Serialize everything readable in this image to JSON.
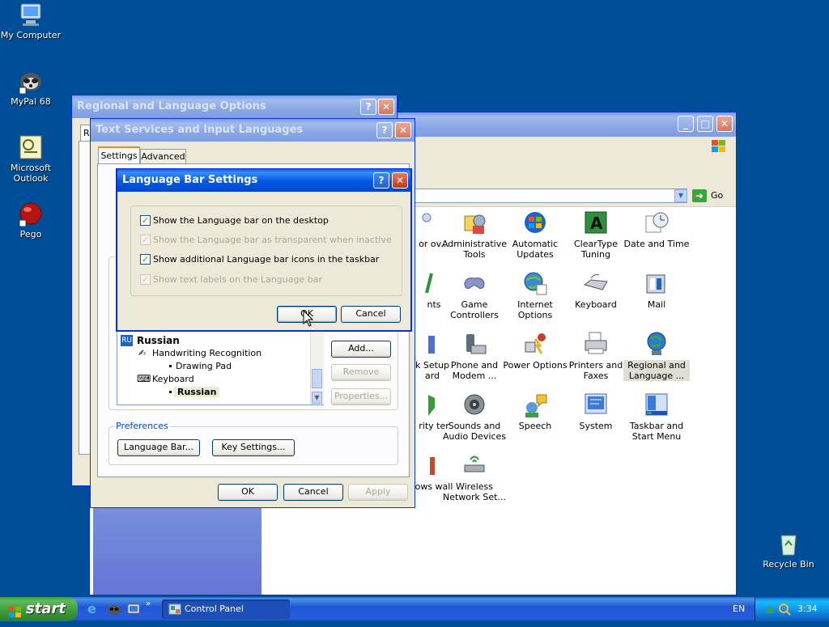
{
  "desktop": {
    "icons": [
      {
        "label": "My Computer"
      },
      {
        "label": "MyPal 68"
      },
      {
        "label": "Microsoft Outlook"
      },
      {
        "label": "Pego"
      },
      {
        "label": "Recycle Bin"
      }
    ]
  },
  "control_panel": {
    "go_label": "Go",
    "items": [
      {
        "label": "or ov..."
      },
      {
        "label": "Administrative Tools"
      },
      {
        "label": "Automatic Updates"
      },
      {
        "label": "ClearType Tuning"
      },
      {
        "label": "Date and Time"
      },
      {
        "label": "nts"
      },
      {
        "label": "Game Controllers"
      },
      {
        "label": "Internet Options"
      },
      {
        "label": "Keyboard"
      },
      {
        "label": "Mail"
      },
      {
        "label": "k Setup ard"
      },
      {
        "label": "Phone and Modem ..."
      },
      {
        "label": "Power Options"
      },
      {
        "label": "Printers and Faxes"
      },
      {
        "label": "Regional and Language ..."
      },
      {
        "label": "rity ter"
      },
      {
        "label": "Sounds and Audio Devices"
      },
      {
        "label": "Speech"
      },
      {
        "label": "System"
      },
      {
        "label": "Taskbar and Start Menu"
      },
      {
        "label": "ows wall"
      },
      {
        "label": "Wireless Network Set..."
      }
    ]
  },
  "regional_window": {
    "title": "Regional and Language Options",
    "tab_fragment": "R"
  },
  "text_services": {
    "title": "Text Services and Input Languages",
    "tabs": [
      "Settings",
      "Advanced"
    ],
    "tree": {
      "lang_code": "RU",
      "language": "Russian",
      "handwriting": "Handwriting Recognition",
      "drawing_pad": "Drawing Pad",
      "keyboard": "Keyboard",
      "keyboard_layout": "Russian"
    },
    "buttons": {
      "add": "Add...",
      "remove": "Remove",
      "properties": "Properties..."
    },
    "preferences": {
      "legend": "Preferences",
      "language_bar": "Language Bar...",
      "key_settings": "Key Settings..."
    },
    "footer": {
      "ok": "OK",
      "cancel": "Cancel",
      "apply": "Apply"
    }
  },
  "language_bar_dialog": {
    "title": "Language Bar Settings",
    "options": [
      {
        "label": "Show the Language bar on the desktop",
        "checked": true,
        "enabled": true
      },
      {
        "label": "Show the Language bar as transparent when inactive",
        "checked": true,
        "enabled": false
      },
      {
        "label": "Show additional Language bar icons in the taskbar",
        "checked": true,
        "enabled": true
      },
      {
        "label": "Show text labels on the Language bar",
        "checked": true,
        "enabled": false
      }
    ],
    "ok": "OK",
    "cancel": "Cancel"
  },
  "taskbar": {
    "start_label": "start",
    "task_label": "Control Panel",
    "language": "EN",
    "clock": "3:34"
  },
  "colors": {
    "desktop": "#004e98",
    "title_active": "#0058e6",
    "dialog_face": "#ece9d8"
  }
}
